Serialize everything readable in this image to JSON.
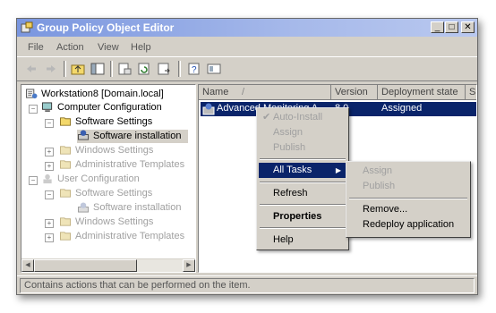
{
  "window": {
    "title": "Group Policy Object Editor",
    "minimize": "_",
    "maximize": "□",
    "close": "✕"
  },
  "menu": [
    "File",
    "Action",
    "View",
    "Help"
  ],
  "toolbar_icons": [
    "back-icon",
    "forward-icon",
    "up-folder-icon",
    "show-tree-icon",
    "properties-icon",
    "refresh-icon",
    "export-icon",
    "help-icon",
    "console-icon"
  ],
  "tree": {
    "root": "Workstation8 [Domain.local]",
    "computer_config": "Computer Configuration",
    "software_settings": "Software Settings",
    "software_installation": "Software installation",
    "windows_settings": "Windows Settings",
    "admin_templates": "Administrative Templates",
    "user_config": "User Configuration",
    "u_software_settings": "Software Settings",
    "u_software_installation": "Software installation",
    "u_windows_settings": "Windows Settings",
    "u_admin_templates": "Administrative Templates"
  },
  "list": {
    "columns": [
      "Name",
      "Version",
      "Deployment state",
      "S"
    ],
    "row": {
      "name": "Advanced Monitoring A...",
      "version": "8.0",
      "state": "Assigned"
    }
  },
  "context_menu": {
    "auto_install": "Auto-Install",
    "assign": "Assign",
    "publish": "Publish",
    "all_tasks": "All Tasks",
    "refresh": "Refresh",
    "properties": "Properties",
    "help": "Help"
  },
  "submenu": {
    "assign": "Assign",
    "publish": "Publish",
    "remove": "Remove...",
    "redeploy": "Redeploy application"
  },
  "status": "Contains actions that can be performed on the item.",
  "colors": {
    "selection": "#0a246a",
    "titlebar": "#7a96df",
    "face": "#d4d0c8"
  }
}
